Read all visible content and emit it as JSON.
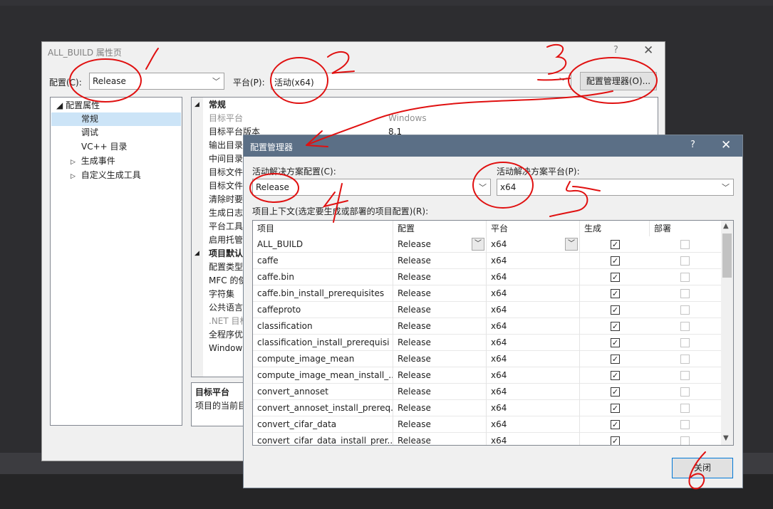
{
  "prop_dialog": {
    "title": "ALL_BUILD 属性页",
    "help": "?",
    "close": "✕",
    "config_label": "配置(C):",
    "config_value": "Release",
    "platform_label": "平台(P):",
    "platform_value": "活动(x64)",
    "config_manager_button": "配置管理器(O)...",
    "tree": {
      "root": "配置属性",
      "items": [
        "常规",
        "调试",
        "VC++ 目录",
        "生成事件",
        "自定义生成工具"
      ]
    },
    "grid": {
      "section1": "常规",
      "rows1": [
        {
          "name": "目标平台",
          "value": "Windows"
        },
        {
          "name": "目标平台版本",
          "value": "8.1"
        },
        {
          "name": "输出目录",
          "value": ""
        },
        {
          "name": "中间目录",
          "value": ""
        },
        {
          "name": "目标文件",
          "value": ""
        },
        {
          "name": "目标文件",
          "value": ""
        },
        {
          "name": "清除时要",
          "value": ""
        },
        {
          "name": "生成日志",
          "value": ""
        },
        {
          "name": "平台工具",
          "value": ""
        },
        {
          "name": "启用托管",
          "value": ""
        }
      ],
      "section2": "项目默认",
      "rows2": [
        "配置类型",
        "MFC 的使",
        "字符集",
        "公共语言",
        ".NET 目标",
        "全程序优",
        "Window"
      ]
    },
    "desc_title": "目标平台",
    "desc_text": "项目的当前目"
  },
  "cfg_dialog": {
    "title": "配置管理器",
    "help": "?",
    "close": "✕",
    "active_config_label": "活动解决方案配置(C):",
    "active_config_value": "Release",
    "active_platform_label": "活动解决方案平台(P):",
    "active_platform_value": "x64",
    "project_context_label": "项目上下文(选定要生成或部署的项目配置)(R):",
    "columns": [
      "项目",
      "配置",
      "平台",
      "生成",
      "部署"
    ],
    "rows": [
      {
        "project": "ALL_BUILD",
        "config": "Release",
        "platform": "x64"
      },
      {
        "project": "caffe",
        "config": "Release",
        "platform": "x64"
      },
      {
        "project": "caffe.bin",
        "config": "Release",
        "platform": "x64"
      },
      {
        "project": "caffe.bin_install_prerequisites",
        "config": "Release",
        "platform": "x64"
      },
      {
        "project": "caffeproto",
        "config": "Release",
        "platform": "x64"
      },
      {
        "project": "classification",
        "config": "Release",
        "platform": "x64"
      },
      {
        "project": "classification_install_prerequisi",
        "config": "Release",
        "platform": "x64"
      },
      {
        "project": "compute_image_mean",
        "config": "Release",
        "platform": "x64"
      },
      {
        "project": "compute_image_mean_install_...",
        "config": "Release",
        "platform": "x64"
      },
      {
        "project": "convert_annoset",
        "config": "Release",
        "platform": "x64"
      },
      {
        "project": "convert_annoset_install_prereq...",
        "config": "Release",
        "platform": "x64"
      },
      {
        "project": "convert_cifar_data",
        "config": "Release",
        "platform": "x64"
      },
      {
        "project": "convert_cifar_data_install_prer...",
        "config": "Release",
        "platform": "x64"
      }
    ],
    "close_button": "关闭"
  },
  "annotations": {
    "color": "#e01010",
    "numbers": [
      "1",
      "2",
      "3",
      "4",
      "5",
      "6"
    ]
  }
}
